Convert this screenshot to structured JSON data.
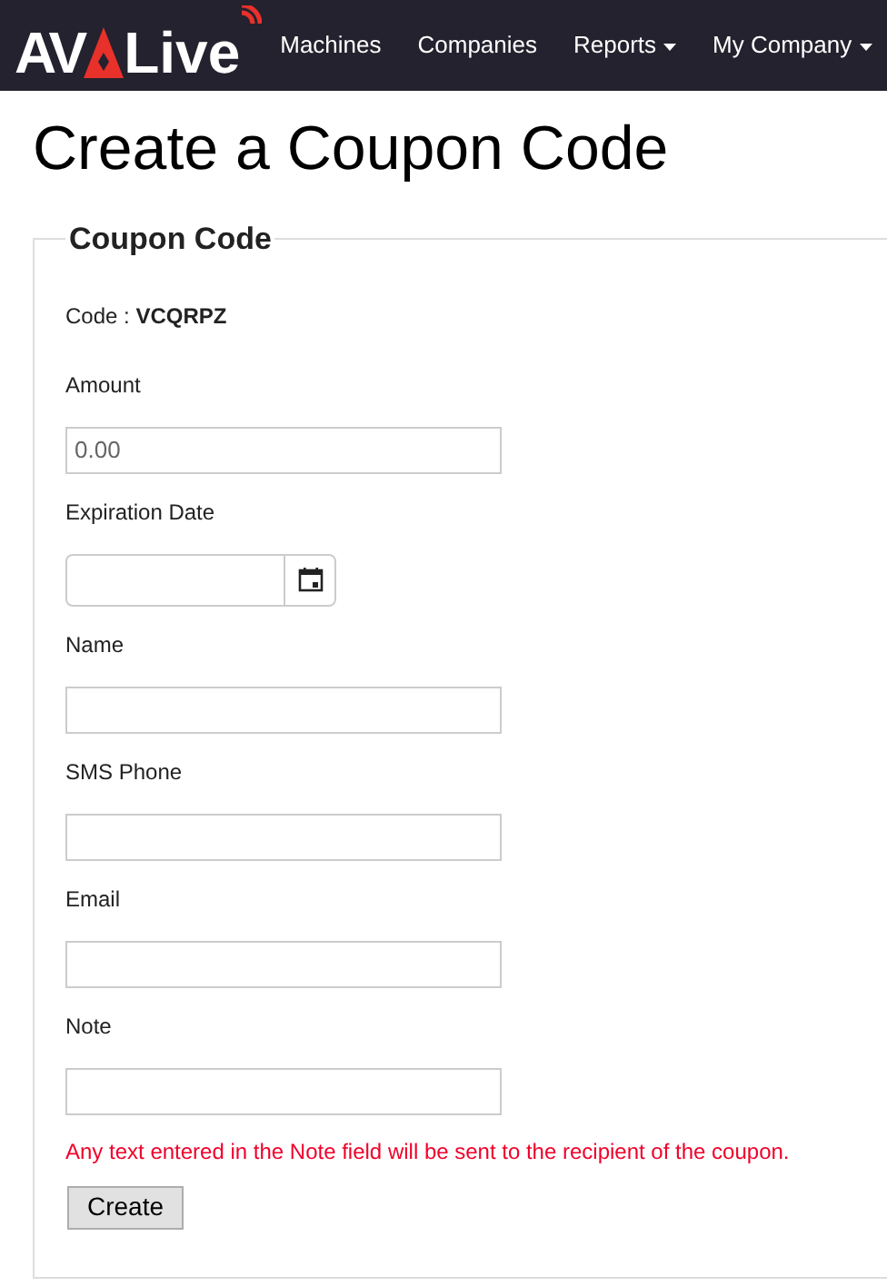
{
  "navbar": {
    "logo": {
      "left": "AV",
      "right": "Live"
    },
    "items": [
      {
        "label": "Machines",
        "dropdown": false
      },
      {
        "label": "Companies",
        "dropdown": false
      },
      {
        "label": "Reports",
        "dropdown": true
      },
      {
        "label": "My Company",
        "dropdown": true
      }
    ]
  },
  "page_title": "Create a Coupon Code",
  "form": {
    "legend": "Coupon Code",
    "code_label": "Code : ",
    "code_value": "VCQRPZ",
    "fields": [
      {
        "label": "Amount",
        "kind": "text",
        "placeholder": "0.00"
      },
      {
        "label": "Expiration Date",
        "kind": "date"
      },
      {
        "label": "Name",
        "kind": "text"
      },
      {
        "label": "SMS Phone",
        "kind": "text"
      },
      {
        "label": "Email",
        "kind": "text"
      },
      {
        "label": "Note",
        "kind": "text"
      }
    ],
    "note": "Any text entered in the Note field will be sent to the recipient of the coupon.",
    "submit": "Create"
  }
}
